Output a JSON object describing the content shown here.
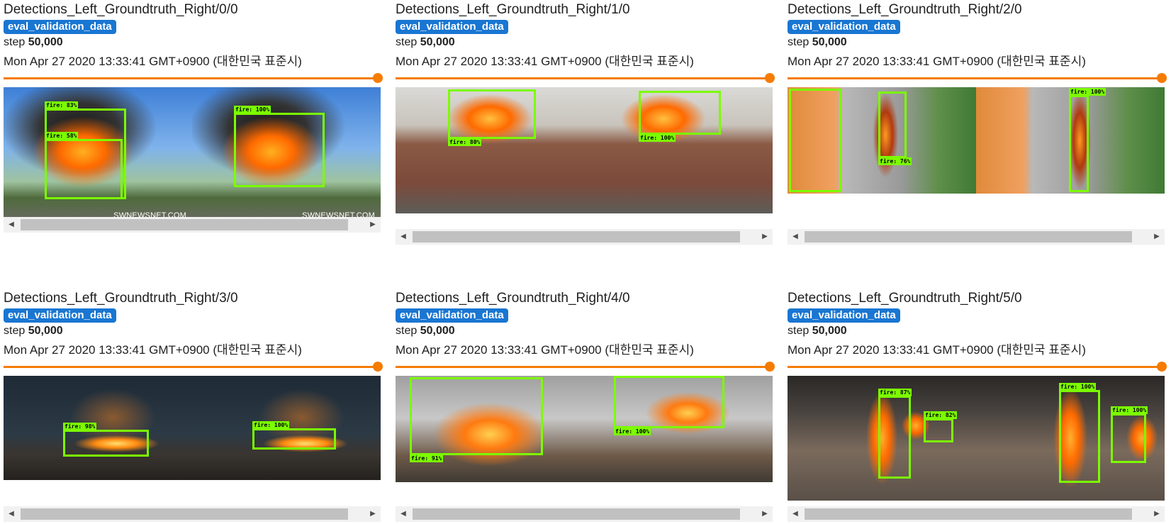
{
  "tag": "eval_validation_data",
  "step_label": "step",
  "step_value": "50,000",
  "timestamp": "Mon Apr 27 2020 13:33:41 GMT+0900 (대한민국 표준시)",
  "cards": [
    {
      "title": "Detections_Left_Groundtruth_Right/0/0",
      "watermark_left": "SWNEWSNET.COM",
      "watermark_right": "SWNEWSNET.COM",
      "detections": [
        "fire: 83%",
        "fire: 58%"
      ],
      "groundtruth": [
        "fire: 100%"
      ]
    },
    {
      "title": "Detections_Left_Groundtruth_Right/1/0",
      "detections": [
        "fire: 80%"
      ],
      "groundtruth": [
        "fire: 100%"
      ]
    },
    {
      "title": "Detections_Left_Groundtruth_Right/2/0",
      "detections": [
        "fire: 76%"
      ],
      "groundtruth": [
        "fire: 100%"
      ]
    },
    {
      "title": "Detections_Left_Groundtruth_Right/3/0",
      "detections": [
        "fire: 98%"
      ],
      "groundtruth": [
        "fire: 100%"
      ]
    },
    {
      "title": "Detections_Left_Groundtruth_Right/4/0",
      "detections": [
        "fire: 91%"
      ],
      "groundtruth": [
        "fire: 100%"
      ]
    },
    {
      "title": "Detections_Left_Groundtruth_Right/5/0",
      "detections": [
        "fire: 87%",
        "fire: 82%"
      ],
      "groundtruth": [
        "fire: 100%",
        "fire: 100%"
      ]
    }
  ],
  "colors": {
    "tag_bg": "#1976d2",
    "slider": "#f57c00",
    "box": "#7cfc00"
  },
  "icons": {
    "scroll_left": "triangle-left-icon",
    "scroll_right": "triangle-right-icon"
  }
}
